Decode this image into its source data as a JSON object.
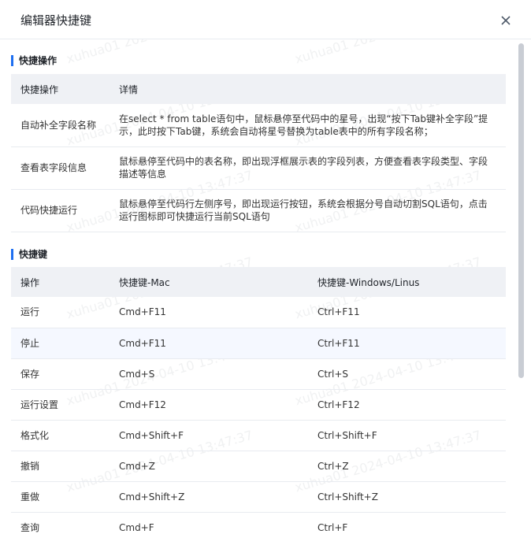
{
  "dialog": {
    "title": "编辑器快捷键"
  },
  "watermark": {
    "text": "xuhua01 2024-04-10 13:47:37"
  },
  "section1": {
    "title": "快捷操作",
    "headers": [
      "快捷操作",
      "详情"
    ],
    "rows": [
      {
        "name": "自动补全字段名称",
        "detail": "在select * from table语句中，鼠标悬停至代码中的星号，出现“按下Tab键补全字段”提示，此时按下Tab键，系统会自动将星号替换为table表中的所有字段名称；"
      },
      {
        "name": "查看表字段信息",
        "detail": "鼠标悬停至代码中的表名称，即出现浮框展示表的字段列表，方便查看表字段类型、字段描述等信息"
      },
      {
        "name": "代码快捷运行",
        "detail": "鼠标悬停至代码行左侧序号，即出现运行按钮，系统会根据分号自动切割SQL语句，点击运行图标即可快捷运行当前SQL语句"
      }
    ]
  },
  "section2": {
    "title": "快捷键",
    "headers": [
      "操作",
      "快捷键-Mac",
      "快捷键-Windows/Linus"
    ],
    "rows": [
      {
        "op": "运行",
        "mac": "Cmd+F11",
        "win": "Ctrl+F11"
      },
      {
        "op": "停止",
        "mac": "Cmd+F11",
        "win": "Ctrl+F11"
      },
      {
        "op": "保存",
        "mac": "Cmd+S",
        "win": "Ctrl+S"
      },
      {
        "op": "运行设置",
        "mac": "Cmd+F12",
        "win": "Ctrl+F12"
      },
      {
        "op": "格式化",
        "mac": "Cmd+Shift+F",
        "win": "Ctrl+Shift+F"
      },
      {
        "op": "撤销",
        "mac": "Cmd+Z",
        "win": "Ctrl+Z"
      },
      {
        "op": "重做",
        "mac": "Cmd+Shift+Z",
        "win": "Ctrl+Shift+Z"
      },
      {
        "op": "查询",
        "mac": "Cmd+F",
        "win": "Ctrl+F"
      }
    ]
  }
}
